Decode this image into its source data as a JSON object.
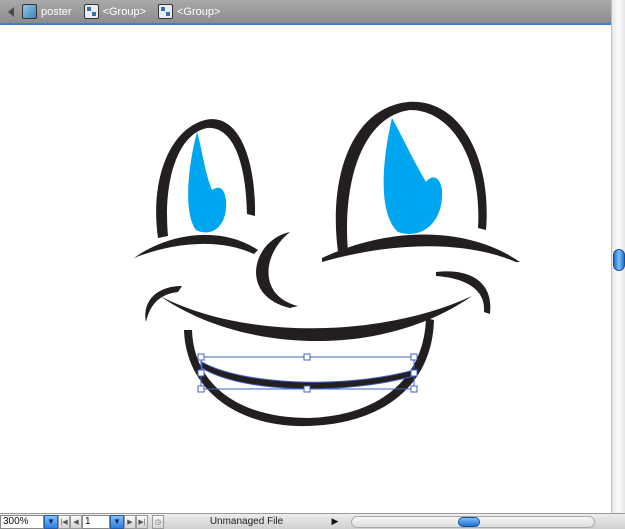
{
  "breadcrumb": {
    "items": [
      {
        "label": "poster",
        "icon": "layer-icon"
      },
      {
        "label": "<Group>",
        "icon": "group-icon"
      },
      {
        "label": "<Group>",
        "icon": "group-icon"
      }
    ]
  },
  "status": {
    "zoom": "300%",
    "page": "1",
    "file_status": "Unmanaged File"
  },
  "colors": {
    "eye_blue": "#00a6f0",
    "ink": "#231f20",
    "selection": "#3f63c8"
  }
}
